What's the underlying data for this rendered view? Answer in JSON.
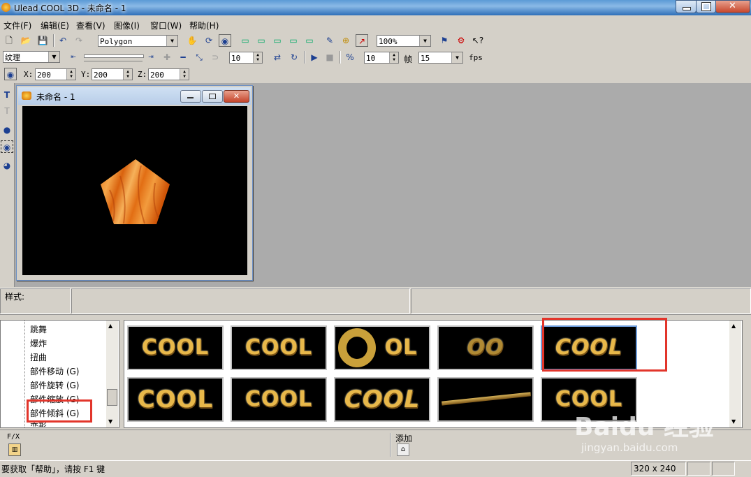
{
  "window": {
    "title": "Ulead COOL 3D - 未命名 - 1"
  },
  "menu": [
    "文件(F)",
    "编辑(E)",
    "查看(V)",
    "图像(I)",
    "窗口(W)",
    "帮助(H)"
  ],
  "toolbar1": {
    "object_type": "Polygon",
    "zoom": "100%"
  },
  "toolbar2": {
    "attribute": "纹理",
    "value_a": "10",
    "value_b": "10",
    "frames_label": "帧",
    "frames": "15",
    "fps_label": "fps"
  },
  "toolbar3": {
    "x_label": "X:",
    "x": "200",
    "y_label": "Y:",
    "y": "200",
    "z_label": "Z:",
    "z": "200"
  },
  "document": {
    "title": "未命名 - 1"
  },
  "style_panel": {
    "label": "样式:"
  },
  "fx_tree": [
    "跳舞",
    "爆炸",
    "扭曲",
    "部件移动 (G)",
    "部件旋转 (G)",
    "部件缩放 (G)",
    "部件倾斜 (G)",
    "变形"
  ],
  "thumbnails": [
    "COOL",
    "COOL",
    "OL",
    "OO",
    "COOL",
    "COOL",
    "COOL",
    "COOL",
    "",
    "COOL"
  ],
  "bottom": {
    "fx_label": "F/X",
    "add_label": "添加"
  },
  "status": {
    "help_text": "要获取「帮助」，请按 F1 键",
    "size": "320 x 240"
  },
  "watermark": {
    "brand": "Baidu 经验",
    "url": "jingyan.baidu.com"
  }
}
